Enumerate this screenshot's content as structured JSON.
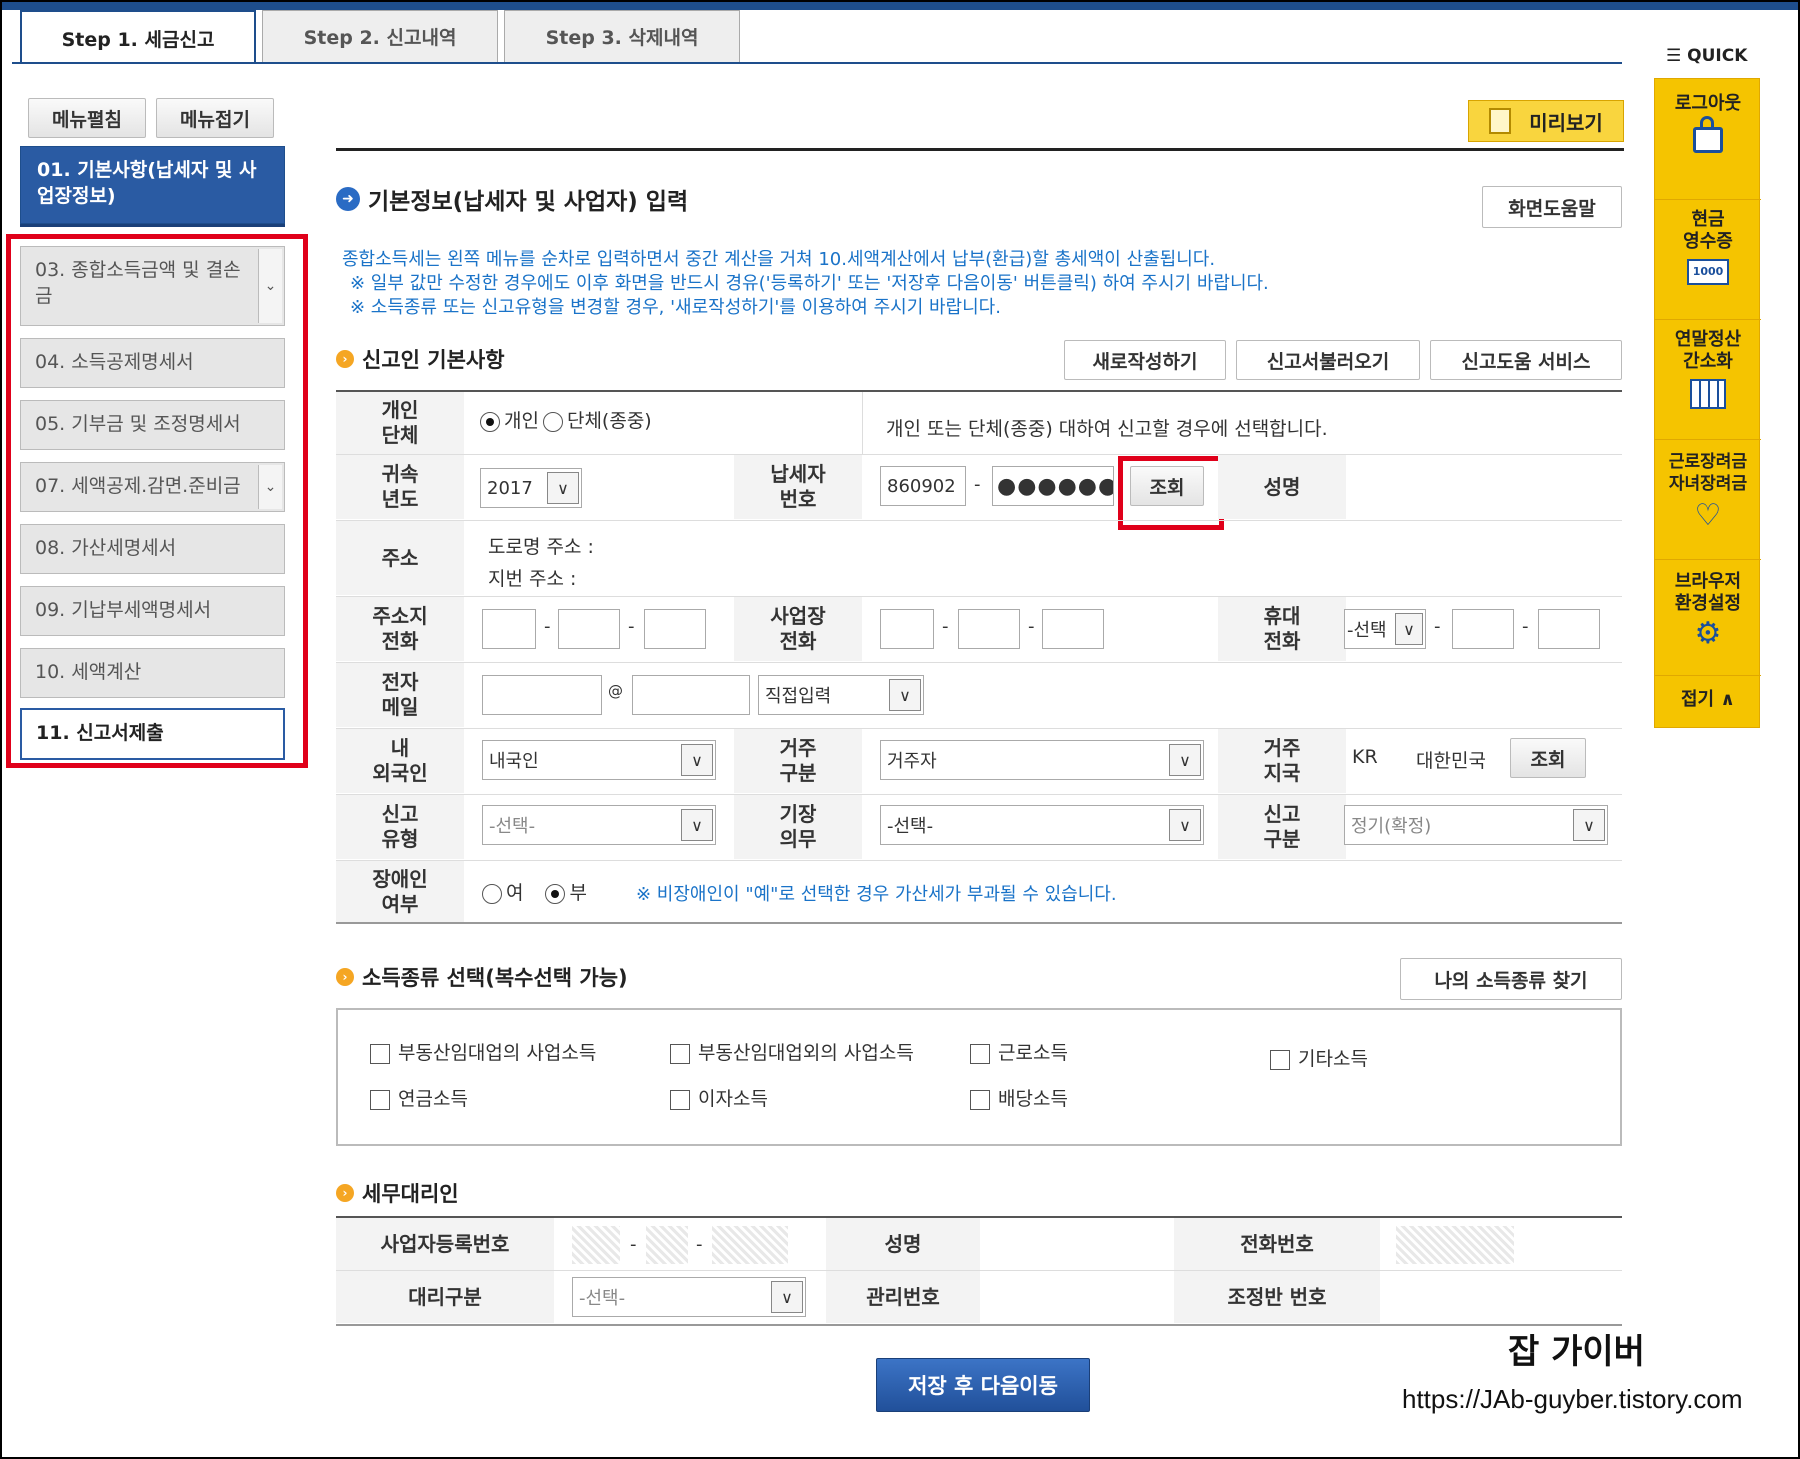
{
  "tabs": [
    "Step 1. 세금신고",
    "Step 2. 신고내역",
    "Step 3. 삭제내역"
  ],
  "quick_title": "QUICK",
  "side": {
    "expand": "메뉴펼침",
    "collapse": "메뉴접기"
  },
  "menu": [
    {
      "label": "01. 기본사항(납세자 및 사업장정보)"
    },
    {
      "label": "03. 종합소득금액 및 결손금"
    },
    {
      "label": "04. 소득공제명세서"
    },
    {
      "label": "05. 기부금 및 조정명세서"
    },
    {
      "label": "07. 세액공제.감면.준비금"
    },
    {
      "label": "08. 가산세명세서"
    },
    {
      "label": "09. 기납부세액명세서"
    },
    {
      "label": "10. 세액계산"
    },
    {
      "label": "11. 신고서제출"
    }
  ],
  "preview_button": "미리보기",
  "page_title": "기본정보(납세자 및 사업자) 입력",
  "help_button": "화면도움말",
  "info": [
    "종합소득세는 왼쪽 메뉴를 순차로 입력하면서 중간 계산을 거쳐 10.세액계산에서 납부(환급)할 총세액이 산출됩니다.",
    "※ 일부 값만 수정한 경우에도 이후 화면을 반드시 경유('등록하기' 또는 '저장후 다음이동' 버튼클릭) 하여 주시기 바랍니다.",
    "※ 소득종류 또는 신고유형을 변경할 경우, '새로작성하기'를 이용하여 주시기 바랍니다."
  ],
  "section1": {
    "title": "신고인 기본사항",
    "buttons": [
      "새로작성하기",
      "신고서불러오기",
      "신고도움 서비스"
    ],
    "labels": {
      "personal": "개인\n단체",
      "year": "귀속\n년도",
      "taxid": "납세자\n번호",
      "name": "성명",
      "address": "주소",
      "home_phone": "주소지\n전화",
      "biz_phone": "사업장\n전화",
      "mobile": "휴대\n전화",
      "email": "전자\n메일",
      "nationality": "내\n외국인",
      "residence": "거주\n구분",
      "res_country": "거주\n지국",
      "report_type": "신고\n유형",
      "bookkeeping": "기장\n의무",
      "report_class": "신고\n구분",
      "disabled": "장애인\n여부"
    },
    "radio_personal": "개인",
    "radio_group": "단체(종중)",
    "personal_note": "개인 또는 단체(종중) 대하여 신고할 경우에 선택합니다.",
    "year": "2017",
    "taxid_front": "860902",
    "taxid_back": "●●●●●●",
    "lookup": "조회",
    "road_address": "도로명 주소 :",
    "lot_address": "지번 주소 :",
    "mobile_select": "-선택",
    "email_at": "@",
    "email_domain": "직접입력",
    "nationality": "내국인",
    "residence": "거주자",
    "country_code": "KR",
    "country_name": "대한민국",
    "report_type": "-선택-",
    "bookkeeping": "-선택-",
    "report_class": "정기(확정)",
    "disabled_yes": "여",
    "disabled_no": "부",
    "disabled_note": "※ 비장애인이 \"예\"로 선택한 경우 가산세가 부과될 수 있습니다."
  },
  "section2": {
    "title": "소득종류 선택(복수선택 가능)",
    "find_button": "나의 소득종류 찾기",
    "items": [
      "부동산임대업의 사업소득",
      "부동산임대업외의 사업소득",
      "근로소득",
      "기타소득",
      "연금소득",
      "이자소득",
      "배당소득"
    ]
  },
  "section3": {
    "title": "세무대리인",
    "labels": [
      "사업자등록번호",
      "성명",
      "전화번호",
      "대리구분",
      "관리번호",
      "조정반 번호"
    ],
    "agent_select": "-선택-"
  },
  "quick": [
    "로그아웃",
    "현금\n영수증",
    "연말정산\n간소화",
    "근로장려금\n자녀장려금",
    "브라우저\n환경설정",
    "접기"
  ],
  "save_button": "저장 후 다음이동",
  "watermark": {
    "title": "잡 가이버",
    "url": "https://JAb-guyber.tistory.com"
  }
}
